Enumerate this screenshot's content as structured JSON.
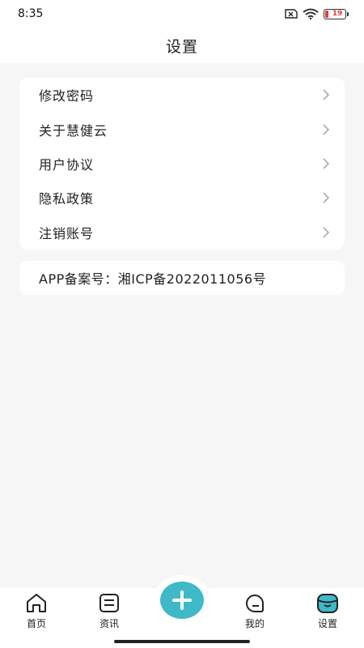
{
  "status_bar": {
    "time": "8:35",
    "battery_level": "19",
    "icons": [
      "sim-error-icon",
      "wifi-icon",
      "battery-icon"
    ]
  },
  "header": {
    "title": "设置"
  },
  "menu": {
    "items": [
      {
        "label": "修改密码",
        "icon": "chevron-right-icon"
      },
      {
        "label": "关于慧健云",
        "icon": "chevron-right-icon"
      },
      {
        "label": "用户协议",
        "icon": "chevron-right-icon"
      },
      {
        "label": "隐私政策",
        "icon": "chevron-right-icon"
      },
      {
        "label": "注销账号",
        "icon": "chevron-right-icon"
      }
    ]
  },
  "icp": {
    "text": "APP备案号：湘ICP备2022011056号"
  },
  "tab_bar": {
    "tabs": [
      {
        "label": "首页",
        "icon": "home-icon"
      },
      {
        "label": "资讯",
        "icon": "news-icon"
      },
      {
        "label": "我的",
        "icon": "profile-icon"
      },
      {
        "label": "设置",
        "icon": "settings-icon",
        "active": true
      }
    ],
    "center_button": {
      "icon": "plus-icon"
    }
  },
  "colors": {
    "accent": "#3fb8c8",
    "background": "#f6f6f6",
    "card": "#ffffff",
    "battery_low": "#e23b3b"
  }
}
